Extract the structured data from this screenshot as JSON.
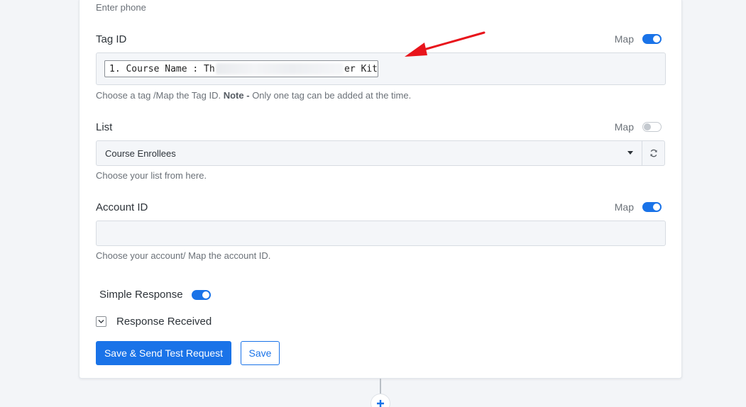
{
  "phone": {
    "hint": "Enter phone"
  },
  "tag": {
    "label": "Tag ID",
    "map_label": "Map",
    "map_on": true,
    "value_start": "1. Course Name : Th",
    "value_end": "er Kit",
    "hint_prefix": "Choose a tag /Map the Tag ID.",
    "hint_note": "Note -",
    "hint_suffix": "Only one tag can be added at the time."
  },
  "list": {
    "label": "List",
    "map_label": "Map",
    "map_on": false,
    "selected": "Course Enrollees",
    "hint": "Choose your list from here."
  },
  "account": {
    "label": "Account ID",
    "map_label": "Map",
    "map_on": true,
    "value": "",
    "hint": "Choose your account/ Map the account ID."
  },
  "simple_response": {
    "label": "Simple Response",
    "on": true
  },
  "response_received": {
    "label": "Response Received",
    "checked": true
  },
  "buttons": {
    "save_send": "Save & Send Test Request",
    "save": "Save"
  },
  "colors": {
    "accent": "#1a73e8",
    "annotation_arrow": "#e8141b"
  },
  "icons": {
    "refresh": "refresh-icon",
    "add": "plus-icon",
    "caret": "caret-down-icon",
    "check": "check-icon"
  }
}
